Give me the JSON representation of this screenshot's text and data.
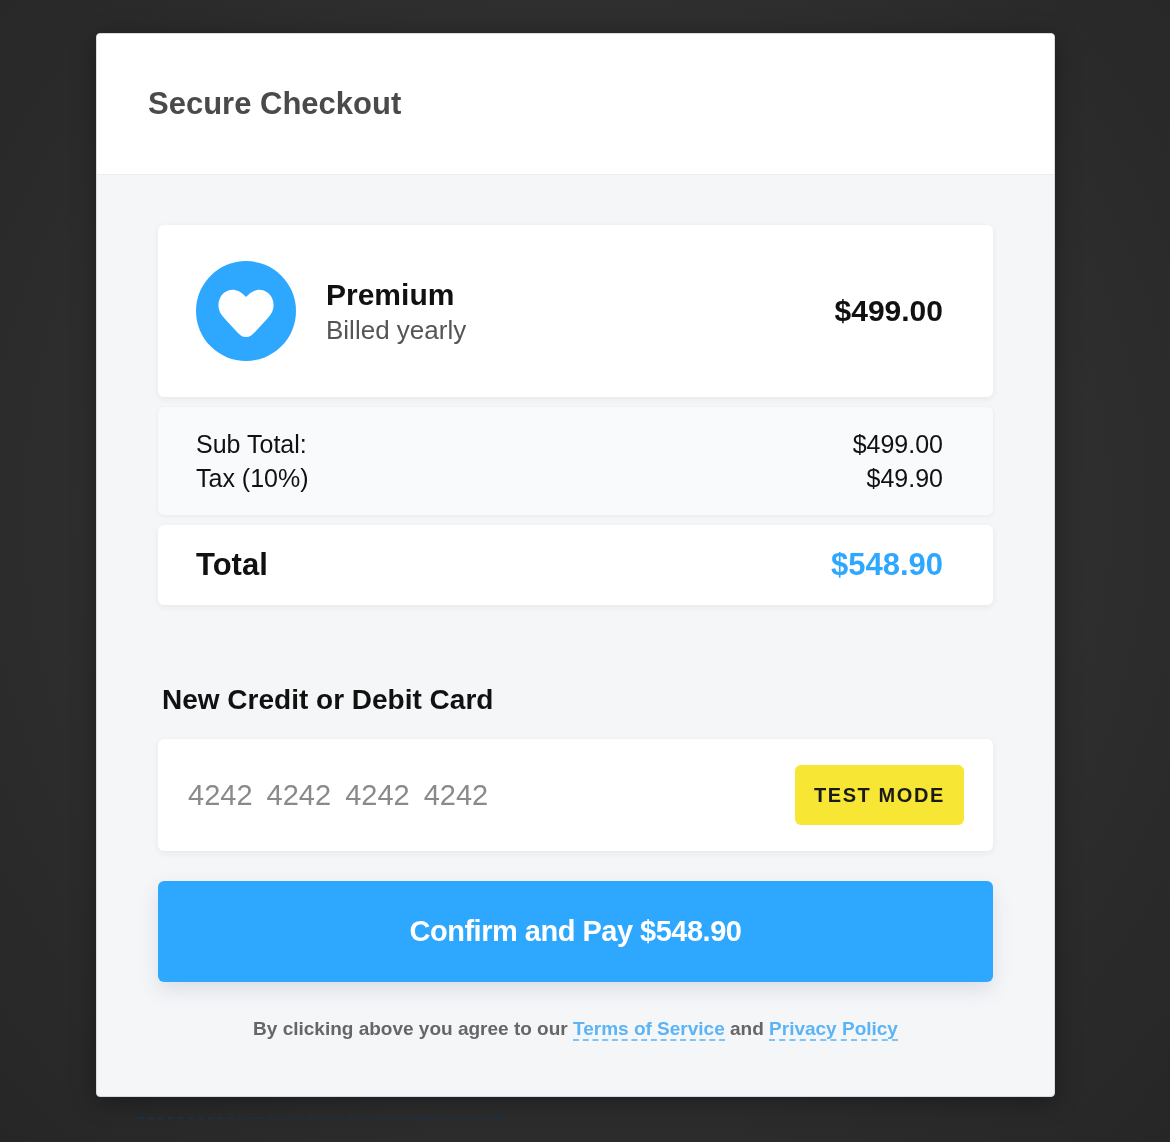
{
  "dialog": {
    "title": "Secure Checkout"
  },
  "product": {
    "name": "Premium",
    "billing": "Billed yearly",
    "price": "$499.00"
  },
  "summary": {
    "rows": [
      {
        "label": "Sub Total:",
        "value": "$499.00"
      },
      {
        "label": "Tax (10%)",
        "value": "$49.90"
      }
    ]
  },
  "total": {
    "label": "Total",
    "value": "$548.90"
  },
  "payment": {
    "heading": "New Credit or Debit Card",
    "card_field": {
      "placeholder": "4242 4242 4242 4242"
    },
    "badge": "TEST MODE"
  },
  "pay_button": {
    "label": "Confirm and Pay $548.90"
  },
  "legal": {
    "parts": [
      {
        "kind": "text",
        "text": "By clicking above you agree to our "
      },
      {
        "kind": "link",
        "text": "Terms of Service"
      },
      {
        "kind": "text",
        "text": " and "
      },
      {
        "kind": "link",
        "text": "Privacy Policy"
      }
    ]
  }
}
